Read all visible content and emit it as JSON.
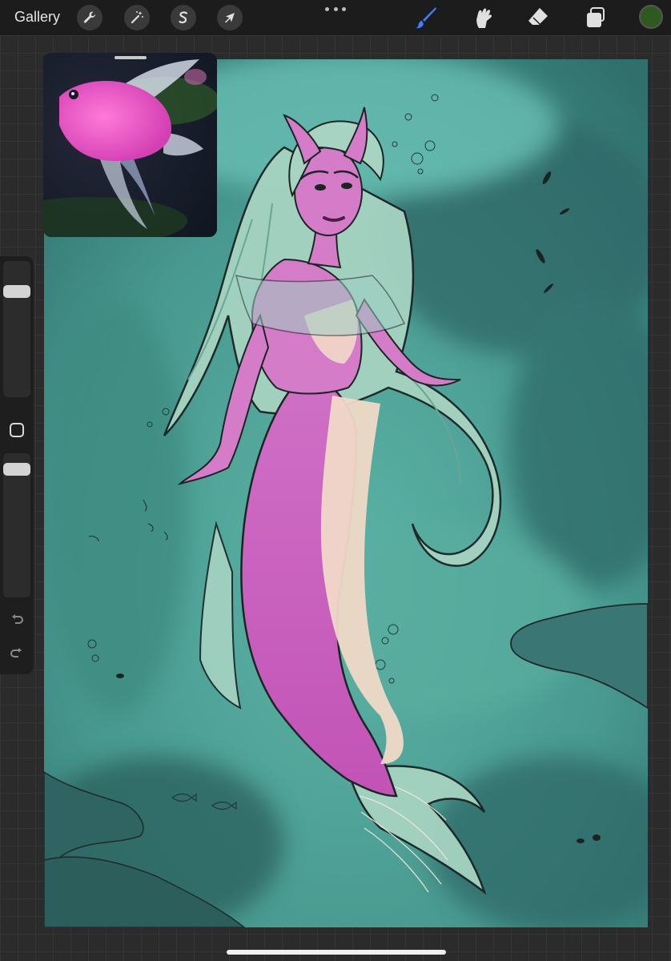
{
  "app": {
    "gallery_label": "Gallery",
    "more_menu": "more-icon",
    "actions_tools": [
      {
        "name": "actions",
        "icon": "wrench-icon"
      },
      {
        "name": "adjustments",
        "icon": "magic-wand-icon"
      },
      {
        "name": "selection",
        "icon": "selection-s-icon"
      },
      {
        "name": "transform",
        "icon": "arrow-cursor-icon"
      }
    ],
    "painting_tools": [
      {
        "name": "brush",
        "icon": "brush-icon",
        "active": true,
        "color": "#3d7fff"
      },
      {
        "name": "smudge",
        "icon": "smudge-icon",
        "active": false
      },
      {
        "name": "eraser",
        "icon": "eraser-icon",
        "active": false
      },
      {
        "name": "layers",
        "icon": "layers-icon",
        "active": false
      }
    ],
    "current_color": "#2f5a1f"
  },
  "sidebar": {
    "brush_size_level": 0.08,
    "opacity_level": 0.06,
    "modify_button": "square-icon",
    "undo": "undo-icon",
    "redo": "redo-icon"
  },
  "canvas": {
    "artwork": "mermaid-illustration",
    "background_color": "#4fa79a"
  },
  "reference": {
    "subject": "pink-angelfish-photo"
  }
}
